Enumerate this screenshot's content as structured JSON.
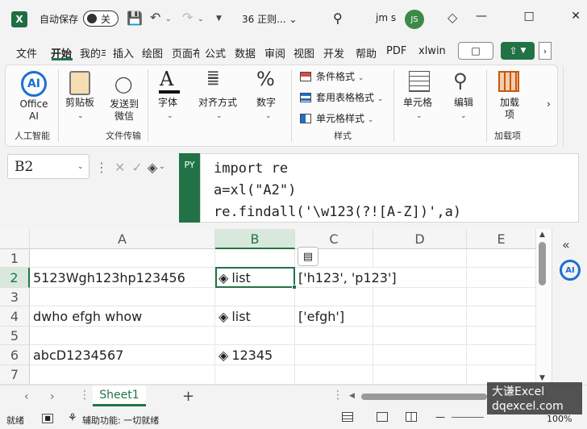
{
  "titlebar": {
    "autosave_label": "自动保存",
    "autosave_state": "关",
    "filename": "36 正则...",
    "user_name": "jm s",
    "avatar": "JS"
  },
  "tabs": [
    "文件",
    "开始",
    "我的丰",
    "插入",
    "绘图",
    "页面布",
    "公式",
    "数据",
    "审阅",
    "视图",
    "开发",
    "帮助",
    "PDF",
    "xlwin"
  ],
  "active_tab": "开始",
  "ribbon": {
    "office_ai": "Office AI",
    "clipboard": "剪贴板",
    "send_wechat": "发送到微信",
    "font": "字体",
    "align": "对齐方式",
    "number": "数字",
    "cond_format": "条件格式",
    "table_format": "套用表格格式",
    "cell_style": "单元格样式",
    "cells": "单元格",
    "edit": "编辑",
    "addins": "加载项",
    "group_ai": "人工智能",
    "group_file": "文件传输",
    "group_style": "样式",
    "group_addins": "加载项"
  },
  "formula_bar": {
    "name_box": "B2",
    "py_badge": "PY",
    "lines": [
      "import re",
      "a=xl(\"A2\")",
      "re.findall('\\w123(?![A-Z])',a)"
    ]
  },
  "grid": {
    "columns": [
      "A",
      "B",
      "C",
      "D",
      "E"
    ],
    "rows": [
      "1",
      "2",
      "3",
      "4",
      "5",
      "6",
      "7"
    ],
    "cells": {
      "A2": "5123Wgh123hp123456",
      "B2": "list",
      "C2": "['h123', 'p123']",
      "A4": "dwho efgh whow",
      "B4": "list",
      "C4": "['efgh']",
      "A6": "abcD1234567",
      "B6": "12345"
    }
  },
  "sheets": [
    "Sheet1"
  ],
  "status": {
    "ready": "就绪",
    "accessibility": "辅助功能: 一切就绪",
    "zoom": "100%"
  },
  "watermark": {
    "line1": "大谦Excel",
    "line2": "dqexcel.com"
  },
  "colors": {
    "accent": "#217346"
  }
}
